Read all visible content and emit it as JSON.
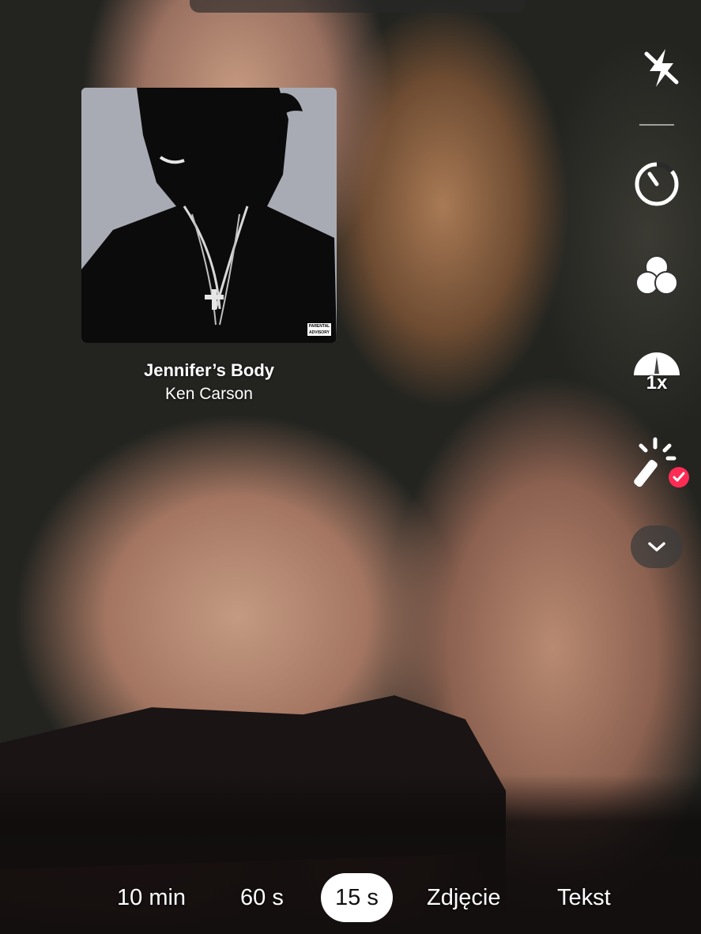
{
  "song": {
    "title": "Jennifer’s Body",
    "artist": "Ken Carson",
    "advisory": "PARENTAL ADVISORY EXPLICIT"
  },
  "toolbar": {
    "items": [
      {
        "icon": "flash-off-icon"
      },
      {
        "icon": "timer-icon"
      },
      {
        "icon": "filters-icon"
      },
      {
        "icon": "speed-icon",
        "label": "1x"
      },
      {
        "icon": "beauty-icon"
      },
      {
        "icon": "chevron-down-icon"
      }
    ]
  },
  "modes": {
    "items": [
      "10 min",
      "60 s",
      "15 s",
      "Zdjęcie",
      "Tekst"
    ],
    "selected": "15 s"
  },
  "colors": {
    "accent": "#fe2c55",
    "active_tab_bg": "#ffffff"
  }
}
